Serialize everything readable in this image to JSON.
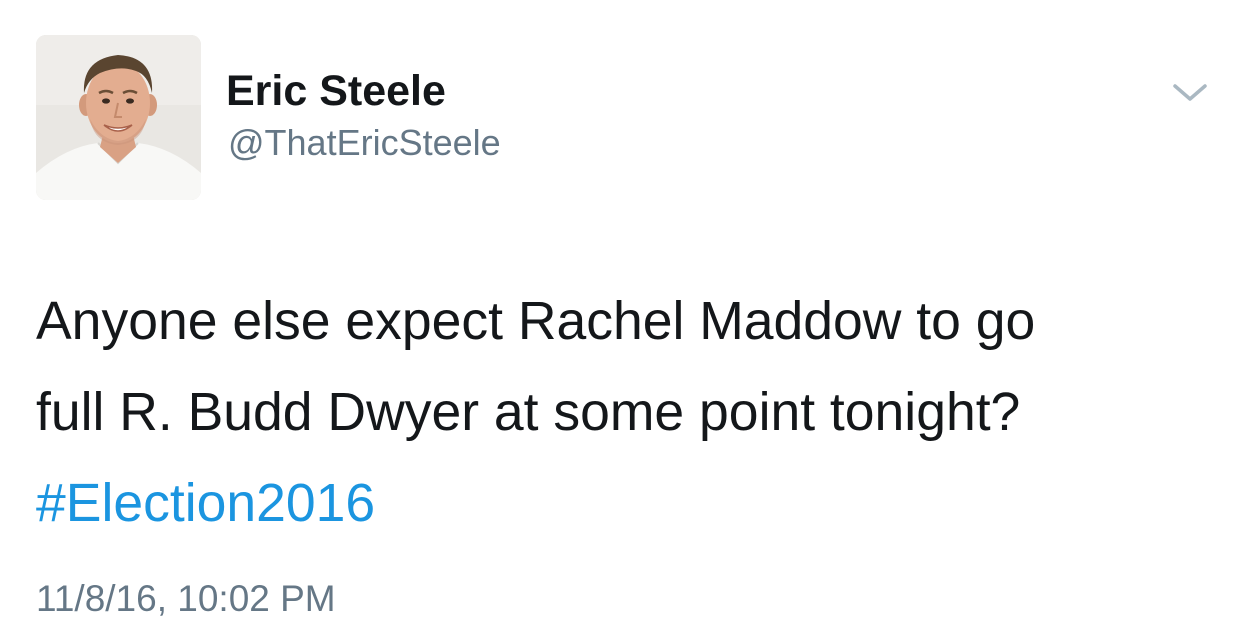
{
  "author": {
    "display_name": "Eric Steele",
    "handle": "@ThatEricSteele",
    "avatar": "profile-photo"
  },
  "tweet": {
    "line1": "Anyone else expect Rachel Maddow to go",
    "line2": "full R. Budd Dwyer at some point tonight?",
    "hashtag": "#Election2016",
    "timestamp": "11/8/16, 10:02 PM"
  },
  "icons": {
    "menu": "chevron-down-icon"
  },
  "colors": {
    "text": "#14171a",
    "secondary": "#657786",
    "link": "#1b95e0",
    "background": "#ffffff"
  }
}
